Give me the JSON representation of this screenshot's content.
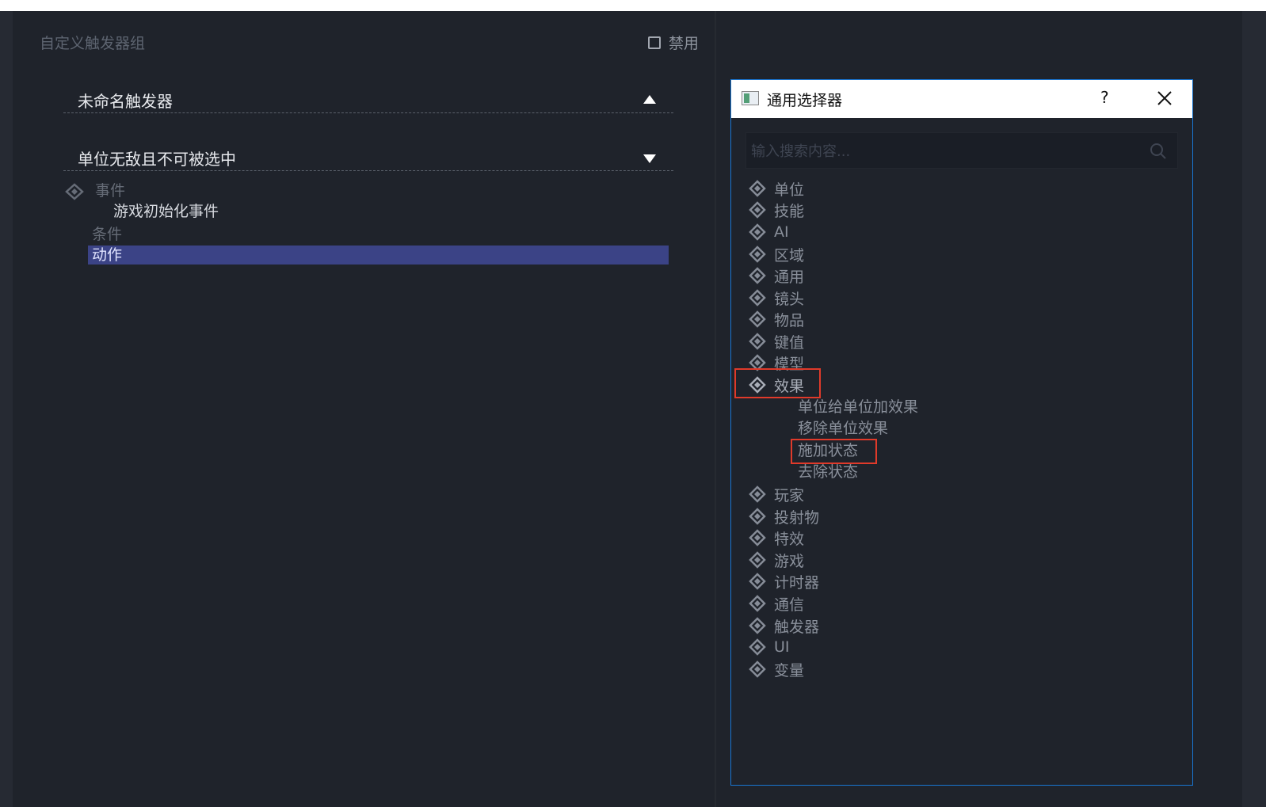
{
  "left_panel": {
    "group_title": "自定义触发器组",
    "disable_label": "禁用",
    "trigger1": {
      "name": "未命名触发器"
    },
    "trigger2": {
      "name": "单位无敌且不可被选中"
    },
    "tree": {
      "event": "事件",
      "event_child": "游戏初始化事件",
      "condition": "条件",
      "action": "动作"
    }
  },
  "dialog": {
    "title": "通用选择器",
    "help": "?",
    "search_placeholder": "输入搜索内容...",
    "categories": [
      "单位",
      "技能",
      "AI",
      "区域",
      "通用",
      "镜头",
      "物品",
      "键值",
      "模型",
      "效果"
    ],
    "effect_children": [
      "单位给单位加效果",
      "移除单位效果",
      "施加状态",
      "去除状态"
    ],
    "categories_after": [
      "玩家",
      "投射物",
      "特效",
      "游戏",
      "计时器",
      "通信",
      "触发器",
      "UI",
      "变量"
    ]
  },
  "colors": {
    "background": "#1f232b",
    "selection": "#3b4386",
    "dialog_border": "#1976d2",
    "highlight_box": "#e03a2a"
  }
}
